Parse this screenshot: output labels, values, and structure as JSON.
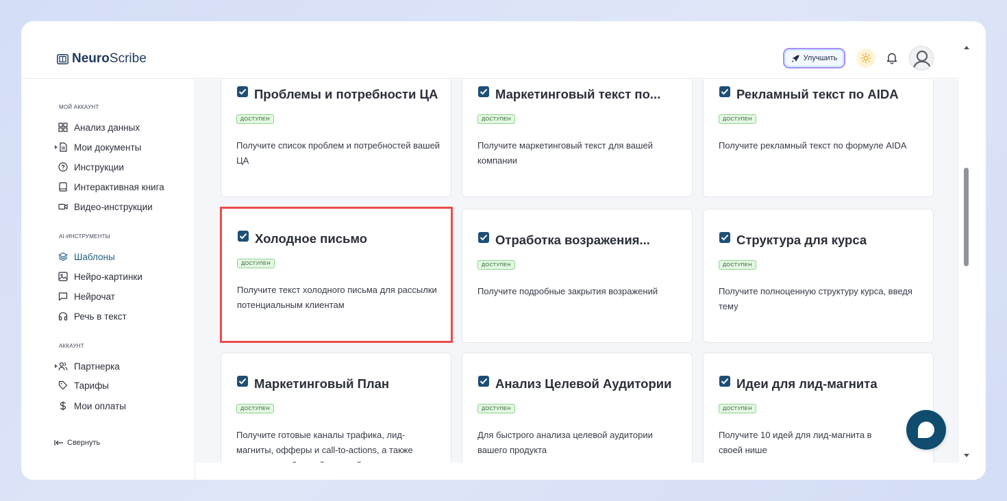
{
  "header": {
    "logo_bold": "Neuro",
    "logo_regular": "Scribe",
    "upgrade_label": "Улучшить"
  },
  "sidebar": {
    "sections": [
      {
        "label": "МОЙ АККАУНТ"
      },
      {
        "label": "AI-ИНСТРУМЕНТЫ"
      },
      {
        "label": "АККАУНТ"
      }
    ],
    "items": [
      {
        "label": "Анализ данных",
        "icon": "grid-icon"
      },
      {
        "label": "Мои документы",
        "icon": "document-icon"
      },
      {
        "label": "Инструкции",
        "icon": "help-circle-icon"
      },
      {
        "label": "Интерактивная книга",
        "icon": "book-icon"
      },
      {
        "label": "Видео-инструкции",
        "icon": "video-icon"
      },
      {
        "label": "Шаблоны",
        "icon": "layers-icon"
      },
      {
        "label": "Нейро-картинки",
        "icon": "image-icon"
      },
      {
        "label": "Нейрочат",
        "icon": "chat-icon"
      },
      {
        "label": "Речь в текст",
        "icon": "headphones-icon"
      },
      {
        "label": "Партнерка",
        "icon": "users-icon"
      },
      {
        "label": "Тарифы",
        "icon": "tag-icon"
      },
      {
        "label": "Мои оплаты",
        "icon": "dollar-icon"
      }
    ],
    "collapse_label": "Свернуть"
  },
  "cards": [
    {
      "title": "Проблемы и потребности ЦА",
      "badge": "доступен",
      "desc": "Получите список проблем и потребностей вашей ЦА"
    },
    {
      "title": "Маркетинговый текст по...",
      "badge": "доступен",
      "desc": "Получите маркетинговый текст для вашей компании"
    },
    {
      "title": "Рекламный текст по AIDA",
      "badge": "доступен",
      "desc": "Получите рекламный текст по формуле AIDA"
    },
    {
      "title": "Холодное письмо",
      "badge": "доступен",
      "desc": "Получите текст холодного письма для рассылки потенциальным клиентам"
    },
    {
      "title": "Отработка возражения...",
      "badge": "доступен",
      "desc": "Получите подробные закрытия возражений"
    },
    {
      "title": "Структура для курса",
      "badge": "доступен",
      "desc": "Получите полноценную структуру курса, введя тему"
    },
    {
      "title": "Маркетинговый План",
      "badge": "доступен",
      "desc": "Получите готовые каналы трафика, лид-магниты, офферы и call-to-actions, а также анализ потребностей целевой аудитории"
    },
    {
      "title": "Анализ Целевой Аудитории",
      "badge": "доступен",
      "desc": "Для быстрого анализа целевой аудитории вашего продукта"
    },
    {
      "title": "Идеи для лид-магнита",
      "badge": "доступен",
      "desc": "Получите 10 идей для лид-магнита в своей нише"
    }
  ],
  "colors": {
    "brand": "#1f3a5f",
    "badge_bg": "#e5f7e4",
    "highlight": "#ee4b4b",
    "fab": "#0f4c6e"
  }
}
